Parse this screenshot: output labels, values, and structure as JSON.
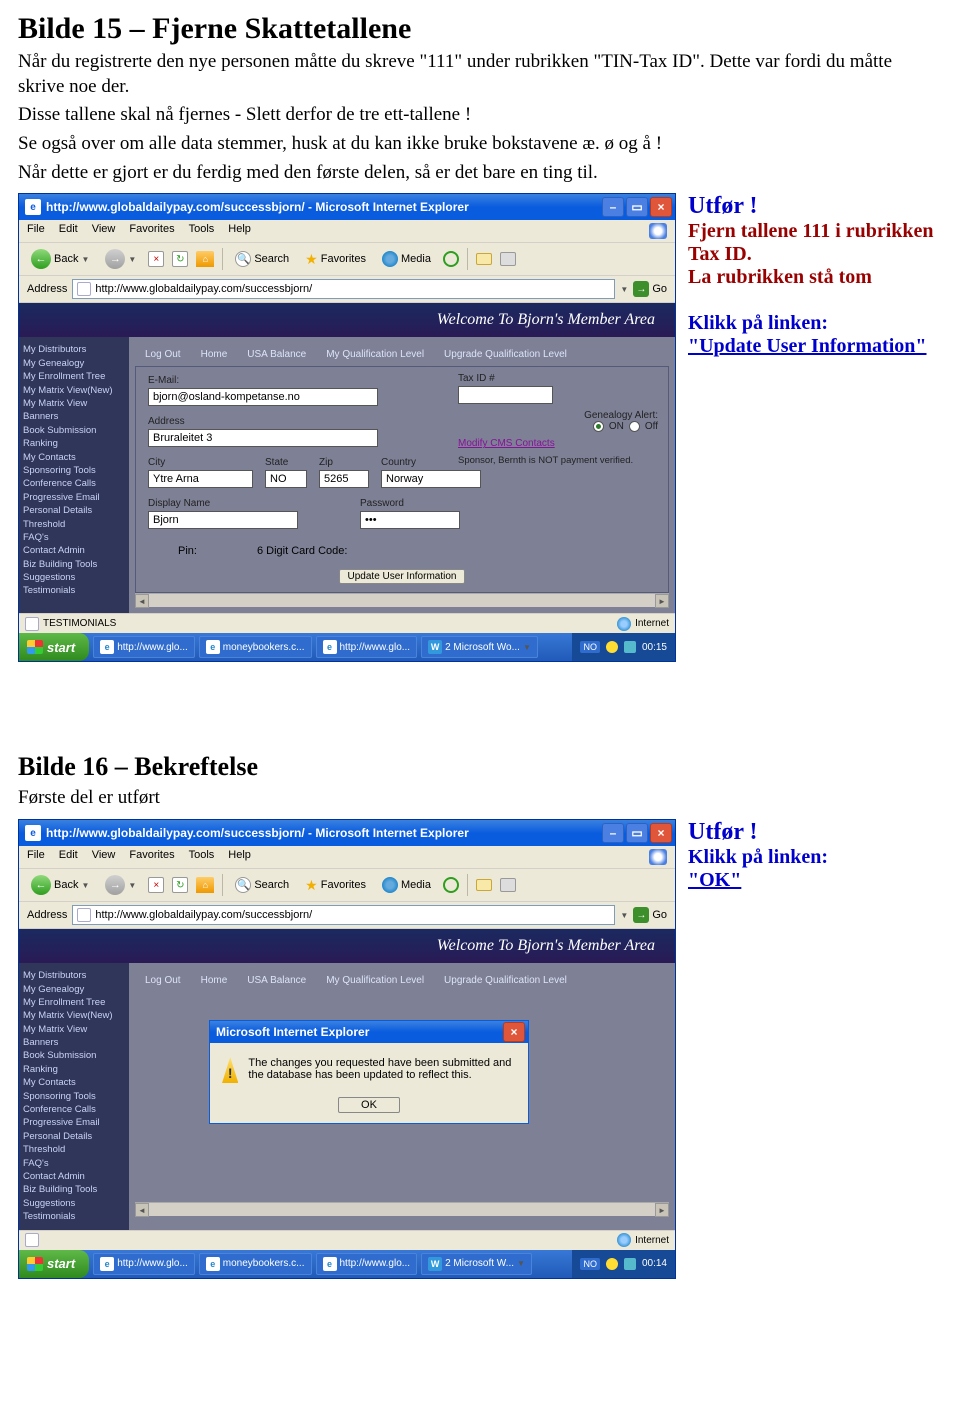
{
  "heading1": "Bilde 15 – Fjerne Skattetallene",
  "para1": "Når du registrerte den nye personen måtte du skreve \"111\" under rubrikken \"TIN-Tax ID\". Dette var fordi du måtte skrive noe der.",
  "para2": "Disse tallene skal nå fjernes - Slett derfor de tre ett-tallene !",
  "para3": "Se også over om alle data stemmer, husk at du kan ikke bruke bokstavene æ. ø og å !",
  "para4": "Når dette er gjort er du ferdig med den første delen, så er det bare en ting til.",
  "cap1": {
    "utfør": "Utfør !",
    "fjern1": "Fjern tallene 111 i rubrikken Tax ID.",
    "fjern2": "La rubrikken stå tom",
    "klikk_label": "Klikk på linken:",
    "klikk_link": "\"Update User Information\""
  },
  "heading2": "Bilde 16 – Bekreftelse",
  "sub2": "Første del er utført",
  "cap2": {
    "utfør": "Utfør !",
    "klikk_label": "Klikk på linken:",
    "klikk_link": "\"OK\""
  },
  "ie": {
    "title": "http://www.globaldailypay.com/successbjorn/ - Microsoft Internet Explorer",
    "menus": [
      "File",
      "Edit",
      "View",
      "Favorites",
      "Tools",
      "Help"
    ],
    "back": "Back",
    "search": "Search",
    "favorites": "Favorites",
    "media": "Media",
    "address_label": "Address",
    "address_url": "http://www.globaldailypay.com/successbjorn/",
    "go": "Go",
    "welcome": "Welcome To Bjorn's Member Area",
    "sidebar": [
      "My Distributors",
      "My Genealogy",
      "My Enrollment Tree",
      "My Matrix View(New)",
      "My Matrix View",
      "Banners",
      "Book Submission",
      "Ranking",
      "My Contacts",
      "Sponsoring Tools",
      "Conference Calls",
      "Progressive Email",
      "Personal Details",
      "Threshold",
      "FAQ's",
      "Contact Admin",
      "Biz Building Tools",
      "Suggestions",
      "Testimonials"
    ],
    "tabs": [
      "Log Out",
      "Home",
      "USA Balance",
      "My Qualification Level",
      "Upgrade Qualification Level"
    ],
    "form": {
      "email_label": "E-Mail:",
      "email": "bjorn@osland-kompetanse.no",
      "address_label": "Address",
      "address": "Bruraleitet 3",
      "city_label": "City",
      "city": "Ytre Arna",
      "state_label": "State",
      "state": "NO",
      "zip_label": "Zip",
      "zip": "5265",
      "country_label": "Country",
      "country": "Norway",
      "display_label": "Display Name",
      "display": "Bjorn",
      "password_label": "Password",
      "password": "•••",
      "pin_label": "Pin:",
      "cardcode_label": "6 Digit Card Code:",
      "taxid_label": "Tax ID #",
      "genealogy_label": "Genealogy Alert:",
      "on": "ON",
      "off": "Off",
      "modify": "Modify CMS Contacts",
      "sponsor": "Sponsor, Bernth is NOT payment verified.",
      "update_btn": "Update User Information"
    },
    "status_left": "TESTIMONIALS",
    "status_right": "Internet",
    "taskbar": {
      "start": "start",
      "t1": "http://www.glo...",
      "t2": "moneybookers.c...",
      "t3": "http://www.glo...",
      "t4": "2 Microsoft Wo...",
      "t4b": "2 Microsoft W...",
      "lang": "NO",
      "clock1": "00:15",
      "clock2": "00:14"
    },
    "dialog": {
      "title": "Microsoft Internet Explorer",
      "msg": "The changes you requested have been submitted and the database has been updated to reflect this.",
      "ok": "OK"
    }
  }
}
